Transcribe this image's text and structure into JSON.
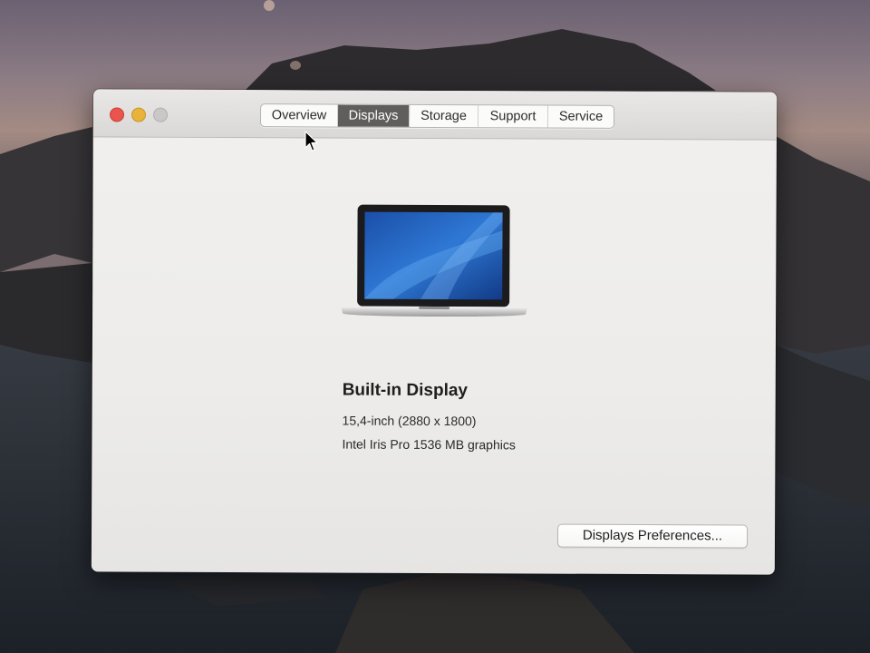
{
  "window": {
    "tabs": [
      {
        "label": "Overview",
        "active": false
      },
      {
        "label": "Displays",
        "active": true
      },
      {
        "label": "Storage",
        "active": false
      },
      {
        "label": "Support",
        "active": false
      },
      {
        "label": "Service",
        "active": false
      }
    ]
  },
  "display": {
    "name": "Built-in Display",
    "size": "15,4-inch (2880 x 1800)",
    "graphics": "Intel Iris Pro 1536 MB graphics"
  },
  "buttons": {
    "preferences_label": "Displays Preferences..."
  },
  "icons": {
    "laptop": "macbook-pro-icon",
    "cursor": "arrow-cursor-icon"
  },
  "colors": {
    "close": "#e9544d",
    "minimize": "#e9b23a",
    "zoom_disabled": "#c9c8c6",
    "active_tab": "#5f5e5c"
  }
}
